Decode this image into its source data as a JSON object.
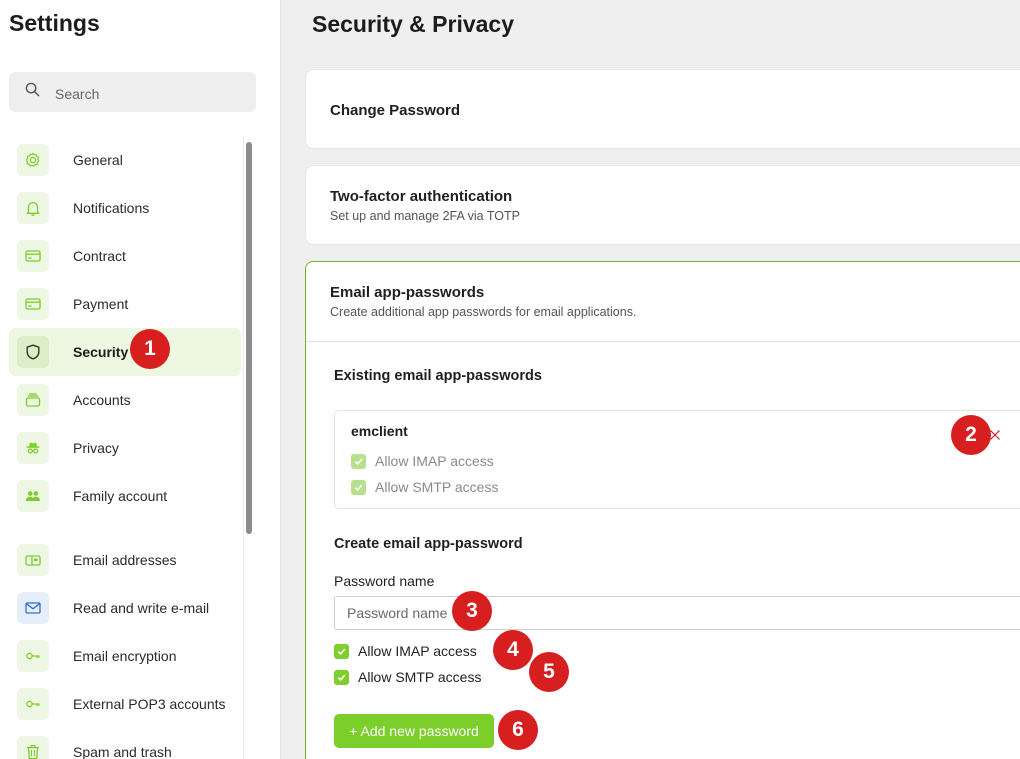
{
  "sidebar": {
    "title": "Settings",
    "search_placeholder": "Search",
    "items": [
      {
        "label": "General",
        "icon": "gear-icon"
      },
      {
        "label": "Notifications",
        "icon": "bell-icon"
      },
      {
        "label": "Contract",
        "icon": "card-icon"
      },
      {
        "label": "Payment",
        "icon": "credit-card-icon"
      },
      {
        "label": "Security",
        "icon": "shield-icon",
        "active": true
      },
      {
        "label": "Accounts",
        "icon": "stack-icon"
      },
      {
        "label": "Privacy",
        "icon": "spy-icon"
      },
      {
        "label": "Family account",
        "icon": "people-icon"
      },
      {
        "label": "Email addresses",
        "icon": "mailbox-icon"
      },
      {
        "label": "Read and write e-mail",
        "icon": "envelope-icon"
      },
      {
        "label": "Email encryption",
        "icon": "key-icon"
      },
      {
        "label": "External POP3 accounts",
        "icon": "key-icon"
      },
      {
        "label": "Spam and trash",
        "icon": "trash-icon"
      }
    ]
  },
  "main": {
    "title": "Security & Privacy",
    "change_password": {
      "title": "Change Password"
    },
    "two_factor": {
      "title": "Two-factor authentication",
      "subtitle": "Set up and manage 2FA via TOTP"
    },
    "app_passwords": {
      "title": "Email app-passwords",
      "subtitle": "Create additional app passwords for email applications.",
      "existing_title": "Existing email app-passwords",
      "existing": {
        "name": "emclient",
        "imap_label": "Allow IMAP access",
        "smtp_label": "Allow SMTP access"
      },
      "create_title": "Create email app-password",
      "name_label": "Password name",
      "name_placeholder": "Password name",
      "imap_label": "Allow IMAP access",
      "smtp_label": "Allow SMTP access",
      "add_button": "+ Add new password"
    }
  },
  "badges": [
    "1",
    "2",
    "3",
    "4",
    "5",
    "6"
  ],
  "colors": {
    "accent": "#7ccf2a",
    "badge": "#d81f1f",
    "active_bg": "#eef8e0",
    "focus_border": "#6fb52c"
  }
}
